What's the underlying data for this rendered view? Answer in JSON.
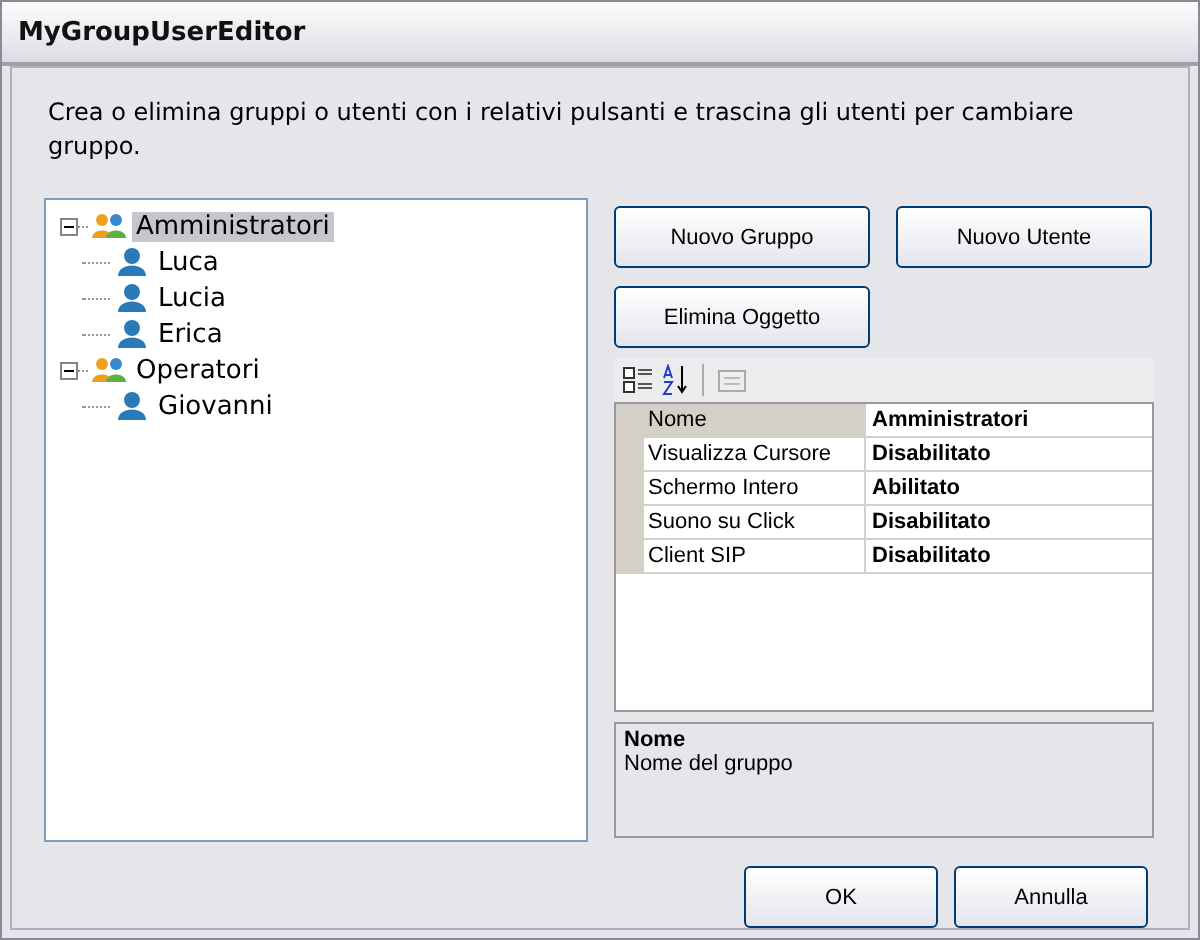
{
  "window": {
    "title": "MyGroupUserEditor"
  },
  "instructions": "Crea o elimina gruppi o utenti con i relativi pulsanti e trascina gli utenti per cambiare gruppo.",
  "tree": [
    {
      "label": "Amministratori",
      "kind": "group",
      "selected": true,
      "expanded": true,
      "children": [
        {
          "label": "Luca",
          "kind": "user",
          "selected": false
        },
        {
          "label": "Lucia",
          "kind": "user",
          "selected": false
        },
        {
          "label": "Erica",
          "kind": "user",
          "selected": false
        }
      ]
    },
    {
      "label": "Operatori",
      "kind": "group",
      "selected": false,
      "expanded": true,
      "children": [
        {
          "label": "Giovanni",
          "kind": "user",
          "selected": false
        }
      ]
    }
  ],
  "buttons": [
    "Nuovo Gruppo",
    "Nuovo Utente",
    "Elimina Oggetto"
  ],
  "properties": [
    {
      "name": "Nome",
      "value": "Amministratori",
      "selected": true
    },
    {
      "name": "Visualizza Cursore",
      "value": "Disabilitato",
      "selected": false
    },
    {
      "name": "Schermo Intero",
      "value": "Abilitato",
      "selected": false
    },
    {
      "name": "Suono su Click",
      "value": "Disabilitato",
      "selected": false
    },
    {
      "name": "Client SIP",
      "value": "Disabilitato",
      "selected": false
    }
  ],
  "description": {
    "title": "Nome",
    "text": "Nome del gruppo"
  },
  "footer_buttons": [
    "OK",
    "Annulla"
  ]
}
